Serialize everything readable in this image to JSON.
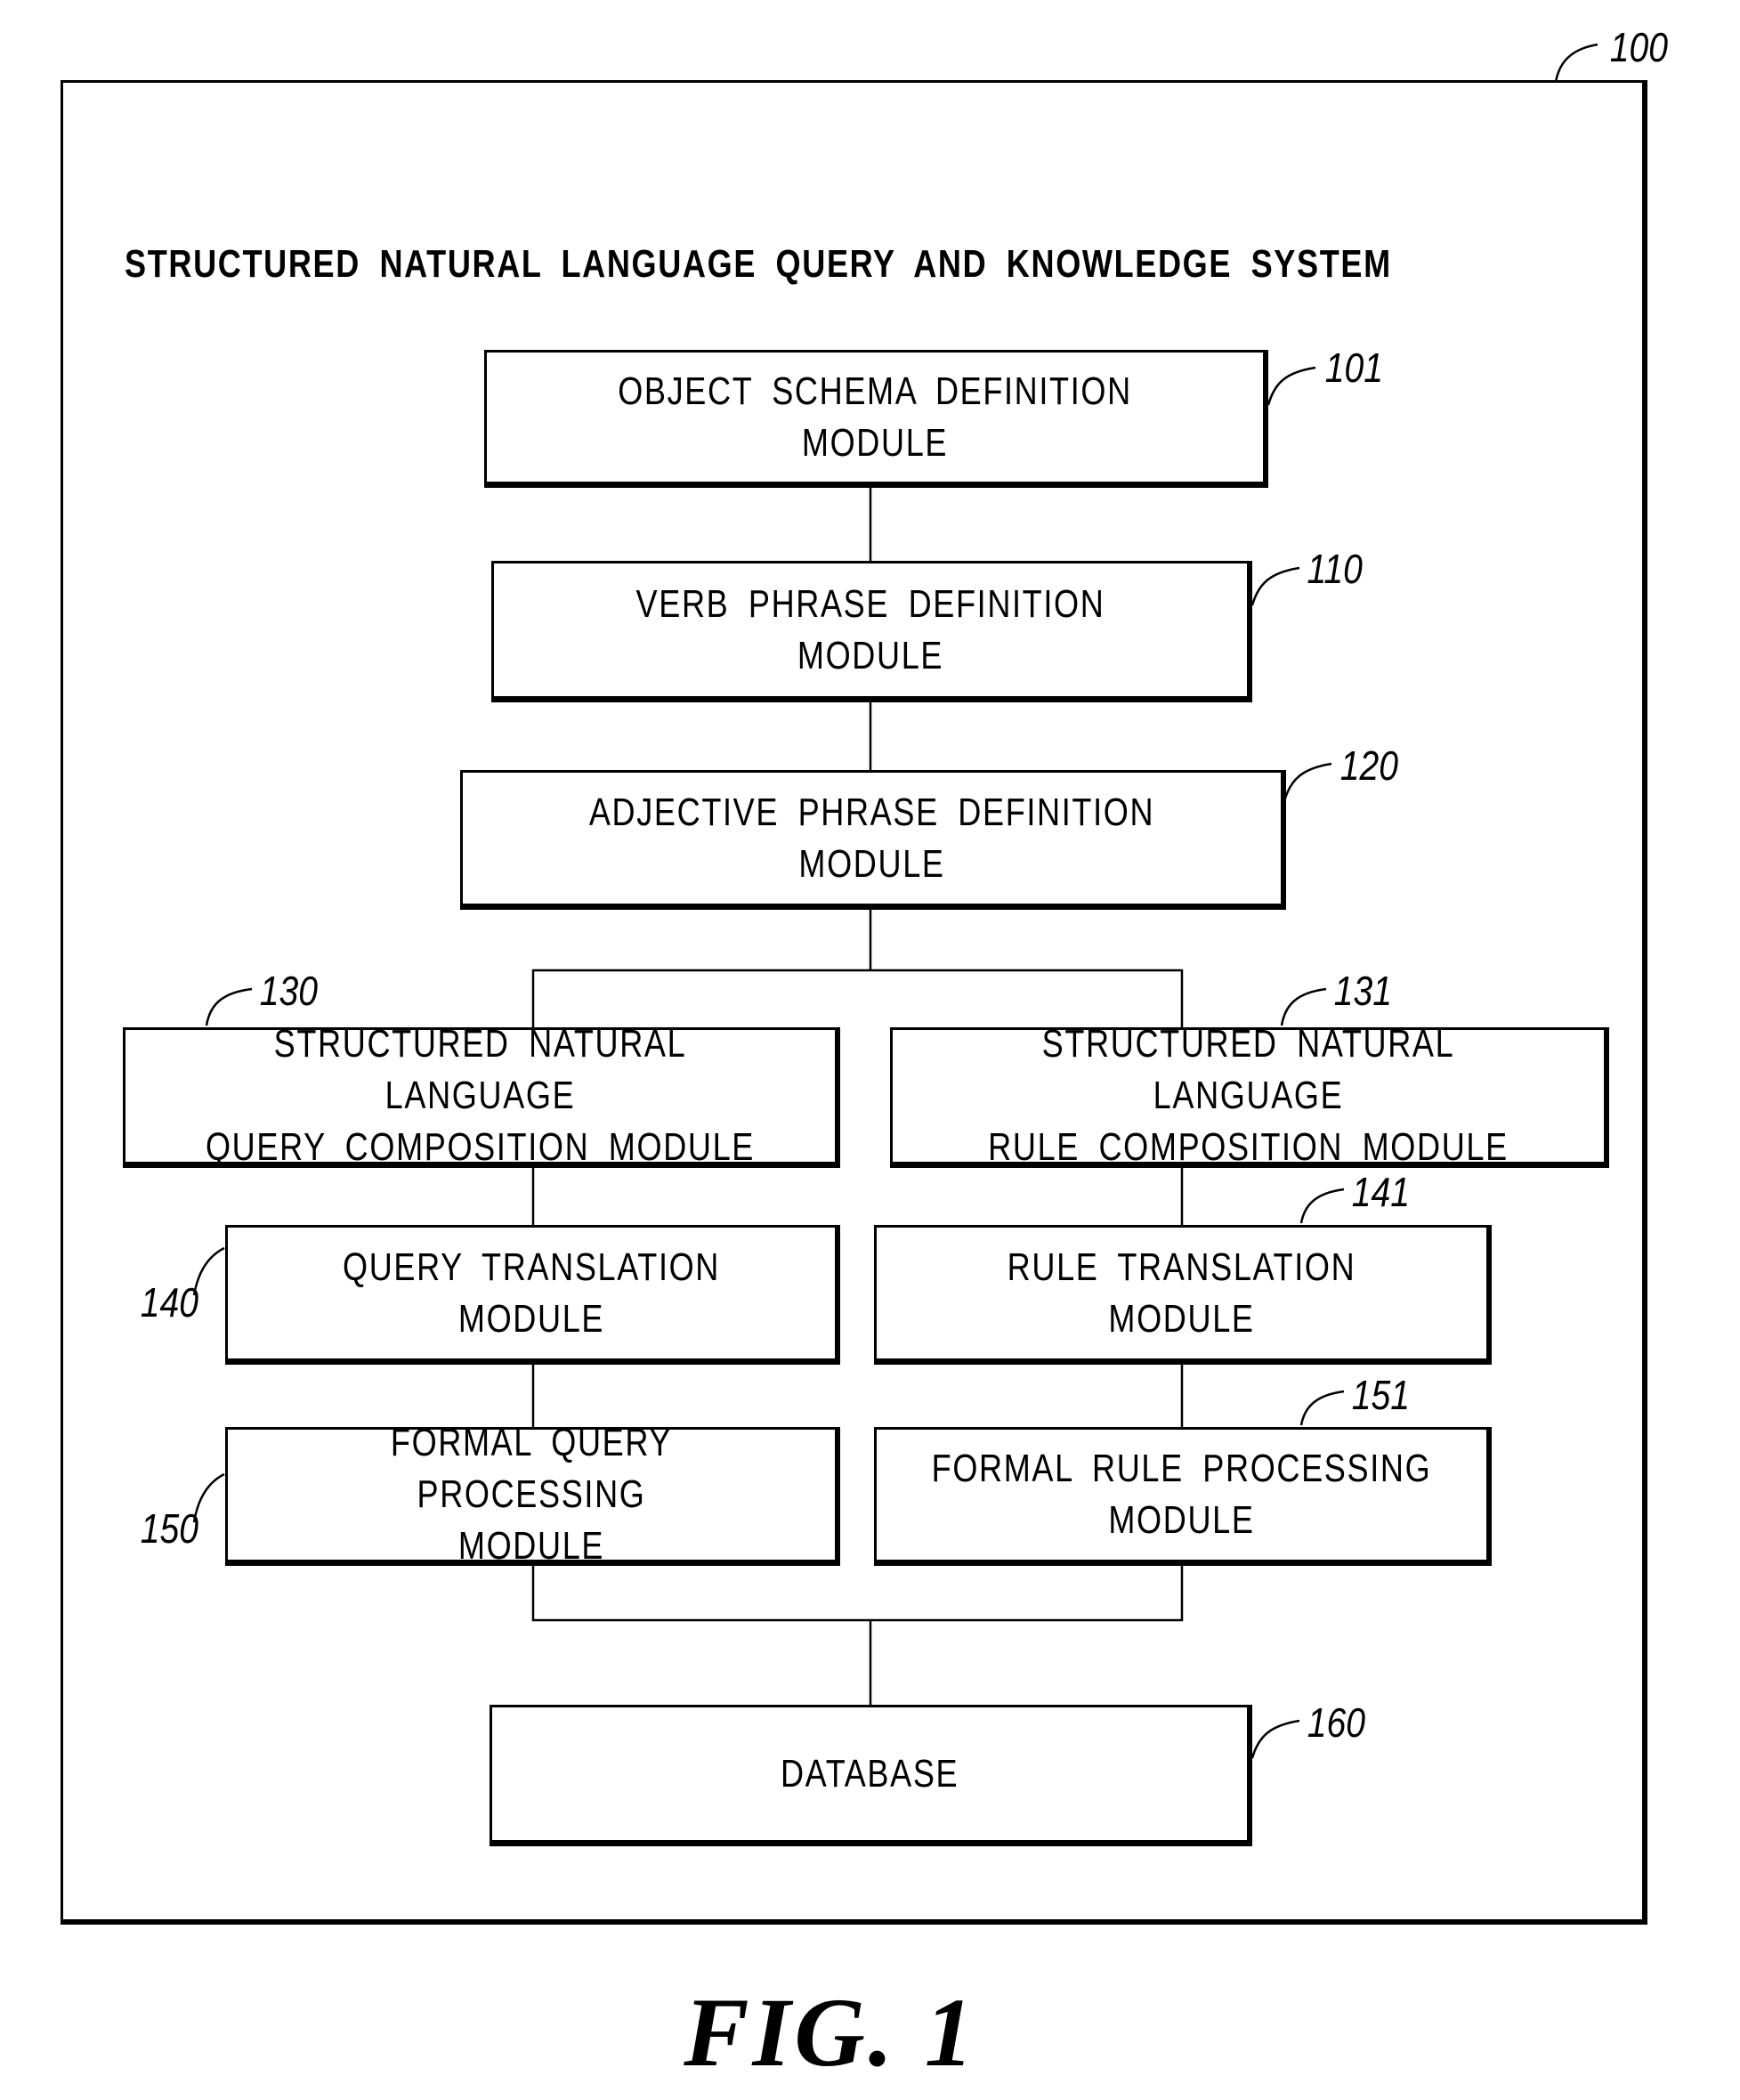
{
  "figure": {
    "label": "FIG. 1",
    "system_ref": "100",
    "system_title": "STRUCTURED NATURAL LANGUAGE QUERY AND KNOWLEDGE SYSTEM"
  },
  "modules": {
    "object_schema": {
      "ref": "101",
      "label": "OBJECT SCHEMA DEFINITION MODULE"
    },
    "verb_phrase": {
      "ref": "110",
      "label": "VERB PHRASE DEFINITION MODULE"
    },
    "adjective_phrase": {
      "ref": "120",
      "label": "ADJECTIVE PHRASE DEFINITION MODULE"
    },
    "query_composition": {
      "ref": "130",
      "label": "STRUCTURED NATURAL LANGUAGE\nQUERY COMPOSITION MODULE"
    },
    "rule_composition": {
      "ref": "131",
      "label": "STRUCTURED NATURAL LANGUAGE\nRULE COMPOSITION MODULE"
    },
    "query_translation": {
      "ref": "140",
      "label": "QUERY TRANSLATION MODULE"
    },
    "rule_translation": {
      "ref": "141",
      "label": "RULE TRANSLATION MODULE"
    },
    "formal_query_processing": {
      "ref": "150",
      "label": "FORMAL QUERY PROCESSING\nMODULE"
    },
    "formal_rule_processing": {
      "ref": "151",
      "label": "FORMAL RULE PROCESSING\nMODULE"
    },
    "database": {
      "ref": "160",
      "label": "DATABASE"
    }
  },
  "connections": [
    [
      "object_schema",
      "verb_phrase"
    ],
    [
      "verb_phrase",
      "adjective_phrase"
    ],
    [
      "adjective_phrase",
      "query_composition"
    ],
    [
      "adjective_phrase",
      "rule_composition"
    ],
    [
      "query_composition",
      "query_translation"
    ],
    [
      "rule_composition",
      "rule_translation"
    ],
    [
      "query_translation",
      "formal_query_processing"
    ],
    [
      "rule_translation",
      "formal_rule_processing"
    ],
    [
      "formal_query_processing",
      "database"
    ],
    [
      "formal_rule_processing",
      "database"
    ]
  ]
}
